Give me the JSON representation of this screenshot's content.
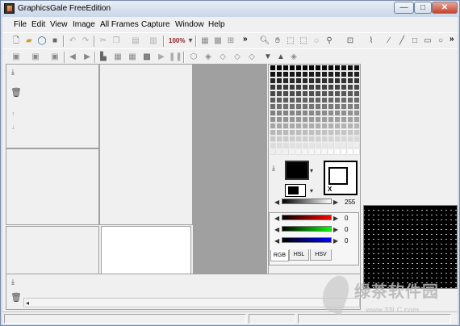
{
  "app": {
    "title": "GraphicsGale FreeEdition"
  },
  "window_controls": {
    "minimize": "—",
    "maximize": "□",
    "close": "✕"
  },
  "menu": [
    "File",
    "Edit",
    "View",
    "Image",
    "All Frames",
    "Capture",
    "Window",
    "Help"
  ],
  "toolbar1": {
    "zoom_value": "100%",
    "icons": [
      "new-file-icon",
      "open-folder-icon",
      "search-icon",
      "save-icon",
      "undo-icon",
      "redo-icon",
      "cut-icon",
      "copy-icon",
      "paste-icon",
      "delete-icon",
      "zoom-icon",
      "grid-icon",
      "grid-dots-icon",
      "crop-icon",
      "more-icon",
      "magnify-icon",
      "hand-icon",
      "select-rect-icon",
      "select-free-icon",
      "magic-wand-icon",
      "stamp-icon",
      "brush-icon",
      "line-icon",
      "rect-icon",
      "ellipse-icon",
      "more-icon"
    ]
  },
  "toolbar2": {
    "icons": [
      "frame-add-icon",
      "frame-delete-icon",
      "frame-play-icon",
      "prev-icon",
      "next-icon",
      "layer-icon",
      "layer-copy-icon",
      "layer-merge-icon",
      "layer-delete-icon",
      "play-icon",
      "pause-icon",
      "layer-add-icon",
      "layer-up-icon",
      "layer-down-icon",
      "layer-lock-icon",
      "chevron-down-icon",
      "chevron-up-icon",
      "layer-props-icon"
    ]
  },
  "color_panel": {
    "value_slider_label": "255",
    "rgb": {
      "r": "0",
      "g": "0",
      "b": "0"
    },
    "tabs": [
      "RGB",
      "HSL",
      "HSV"
    ],
    "active_tab": "RGB",
    "swap_label": "X",
    "foreground_color": "#000000",
    "background_color": "#ffffff"
  },
  "watermark": {
    "text": "绿茶软件园",
    "url": "www.33LC.com"
  }
}
